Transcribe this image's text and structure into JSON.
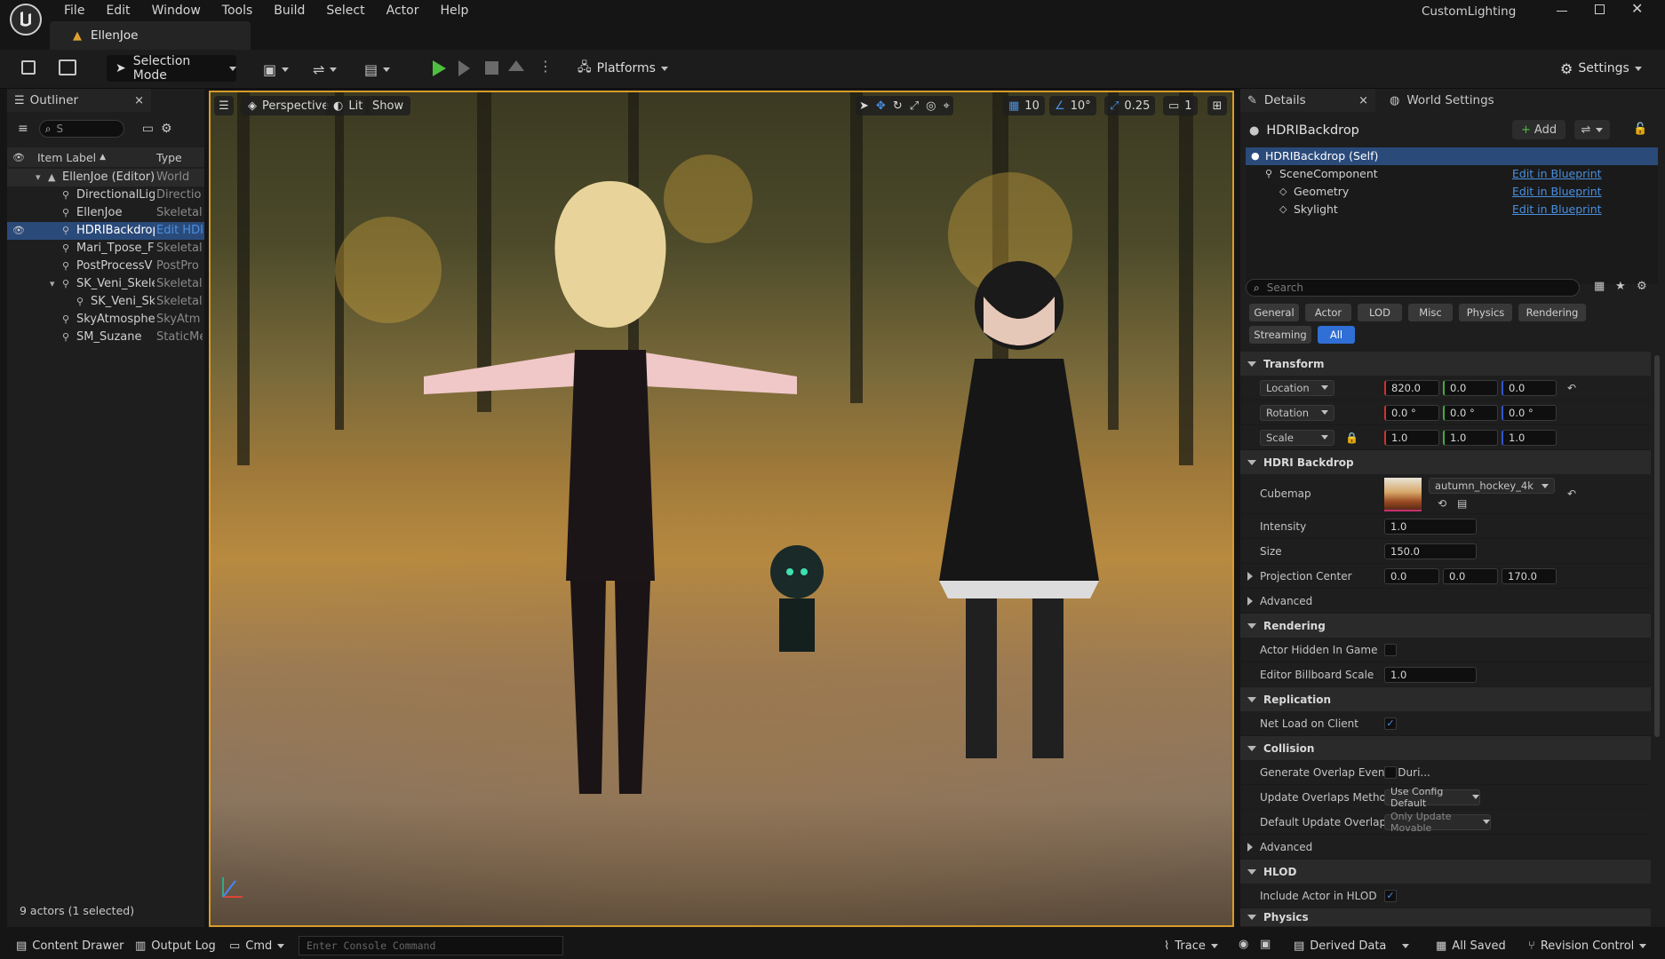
{
  "app": {
    "project_name": "CustomLighting",
    "level_tab": "EllenJoe",
    "menu": [
      "File",
      "Edit",
      "Window",
      "Tools",
      "Build",
      "Select",
      "Actor",
      "Help"
    ]
  },
  "toolbar": {
    "selection_mode": "Selection Mode",
    "platforms": "Platforms",
    "settings": "Settings"
  },
  "outliner": {
    "tab_title": "Outliner",
    "search_value": "S",
    "col_label": "Item Label",
    "col_type": "Type",
    "rows": [
      {
        "label": "EllenJoe (Editor)",
        "type": "World",
        "indent": 0
      },
      {
        "label": "DirectionalLigl",
        "type": "Directio",
        "indent": 1
      },
      {
        "label": "EllenJoe",
        "type": "Skeletal",
        "indent": 1
      },
      {
        "label": "HDRIBackdrop",
        "type": "Edit HDI",
        "indent": 1
      },
      {
        "label": "Mari_Tpose_F",
        "type": "Skeletal",
        "indent": 1
      },
      {
        "label": "PostProcessV",
        "type": "PostPro",
        "indent": 1
      },
      {
        "label": "SK_Veni_Skele",
        "type": "Skeletal",
        "indent": 1
      },
      {
        "label": "SK_Veni_Ske",
        "type": "Skeletal",
        "indent": 2
      },
      {
        "label": "SkyAtmosphe",
        "type": "SkyAtm",
        "indent": 1
      },
      {
        "label": "SM_Suzane",
        "type": "StaticMe",
        "indent": 1
      }
    ],
    "status": "9 actors (1 selected)"
  },
  "viewport": {
    "perspective": "Perspective",
    "lit": "Lit",
    "show": "Show",
    "grid_snap": "10",
    "rot_snap": "10°",
    "scale_snap": "0.25",
    "camera_speed": "1"
  },
  "details": {
    "tab_title": "Details",
    "world_settings_tab": "World Settings",
    "actor_name": "HDRIBackdrop",
    "add_button": "Add",
    "components": [
      {
        "name": "HDRIBackdrop (Self)",
        "link": ""
      },
      {
        "name": "SceneComponent",
        "link": "Edit in Blueprint"
      },
      {
        "name": "Geometry",
        "link": "Edit in Blueprint"
      },
      {
        "name": "Skylight",
        "link": "Edit in Blueprint"
      }
    ],
    "search_placeholder": "Search",
    "categories": [
      "General",
      "Actor",
      "LOD",
      "Misc",
      "Physics",
      "Rendering"
    ],
    "categories_row2": [
      "Streaming",
      "All"
    ],
    "transform": {
      "title": "Transform",
      "location_label": "Location",
      "rotation_label": "Rotation",
      "scale_label": "Scale",
      "location": [
        "820.0",
        "0.0",
        "0.0"
      ],
      "rotation": [
        "0.0 °",
        "0.0 °",
        "0.0 °"
      ],
      "scale": [
        "1.0",
        "1.0",
        "1.0"
      ]
    },
    "hdri": {
      "title": "HDRI Backdrop",
      "cubemap_label": "Cubemap",
      "cubemap_value": "autumn_hockey_4k",
      "intensity_label": "Intensity",
      "intensity": "1.0",
      "size_label": "Size",
      "size": "150.0",
      "projection_label": "Projection Center",
      "projection": [
        "0.0",
        "0.0",
        "170.0"
      ],
      "advanced": "Advanced"
    },
    "rendering": {
      "title": "Rendering",
      "hidden_label": "Actor Hidden In Game",
      "billboard_label": "Editor Billboard Scale",
      "billboard": "1.0"
    },
    "replication": {
      "title": "Replication",
      "net_load_label": "Net Load on Client"
    },
    "collision": {
      "title": "Collision",
      "overlap_label": "Generate Overlap Events Duri...",
      "update_method_label": "Update Overlaps Method Duri...",
      "update_method_value": "Use Config Default",
      "default_update_label": "Default Update Overlaps Met...",
      "default_update_value": "Only Update Movable",
      "advanced": "Advanced"
    },
    "hlod": {
      "title": "HLOD",
      "include_label": "Include Actor in HLOD"
    },
    "physics": {
      "title": "Physics"
    }
  },
  "bottom": {
    "content_drawer": "Content Drawer",
    "output_log": "Output Log",
    "cmd": "Cmd",
    "console_placeholder": "Enter Console Command",
    "trace": "Trace",
    "derived_data": "Derived Data",
    "all_saved": "All Saved",
    "revision_control": "Revision Control"
  },
  "colors": {
    "accent": "#2f6fd6",
    "selection": "#2a4a7a",
    "play_green": "#4fbf3f",
    "viewport_border": "#d89b2a"
  }
}
